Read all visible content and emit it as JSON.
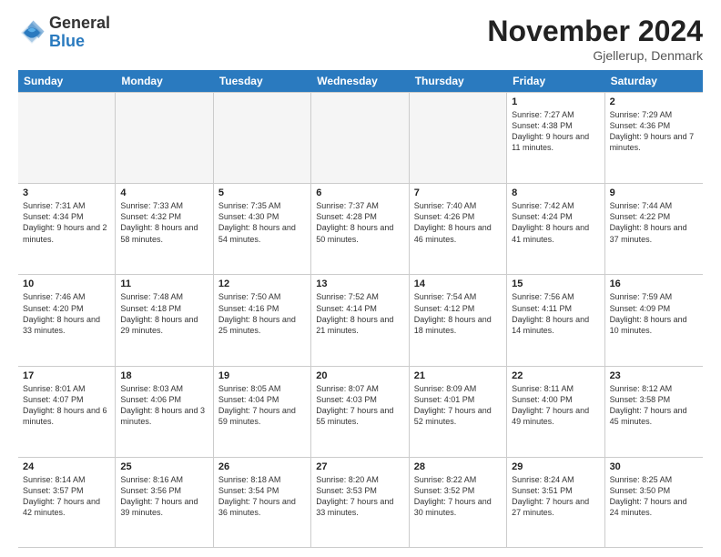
{
  "header": {
    "logo_general": "General",
    "logo_blue": "Blue",
    "month_title": "November 2024",
    "location": "Gjellerup, Denmark"
  },
  "days_of_week": [
    "Sunday",
    "Monday",
    "Tuesday",
    "Wednesday",
    "Thursday",
    "Friday",
    "Saturday"
  ],
  "weeks": [
    [
      {
        "day": "",
        "empty": true
      },
      {
        "day": "",
        "empty": true
      },
      {
        "day": "",
        "empty": true
      },
      {
        "day": "",
        "empty": true
      },
      {
        "day": "",
        "empty": true
      },
      {
        "day": "1",
        "sunrise": "Sunrise: 7:27 AM",
        "sunset": "Sunset: 4:38 PM",
        "daylight": "Daylight: 9 hours and 11 minutes."
      },
      {
        "day": "2",
        "sunrise": "Sunrise: 7:29 AM",
        "sunset": "Sunset: 4:36 PM",
        "daylight": "Daylight: 9 hours and 7 minutes."
      }
    ],
    [
      {
        "day": "3",
        "sunrise": "Sunrise: 7:31 AM",
        "sunset": "Sunset: 4:34 PM",
        "daylight": "Daylight: 9 hours and 2 minutes."
      },
      {
        "day": "4",
        "sunrise": "Sunrise: 7:33 AM",
        "sunset": "Sunset: 4:32 PM",
        "daylight": "Daylight: 8 hours and 58 minutes."
      },
      {
        "day": "5",
        "sunrise": "Sunrise: 7:35 AM",
        "sunset": "Sunset: 4:30 PM",
        "daylight": "Daylight: 8 hours and 54 minutes."
      },
      {
        "day": "6",
        "sunrise": "Sunrise: 7:37 AM",
        "sunset": "Sunset: 4:28 PM",
        "daylight": "Daylight: 8 hours and 50 minutes."
      },
      {
        "day": "7",
        "sunrise": "Sunrise: 7:40 AM",
        "sunset": "Sunset: 4:26 PM",
        "daylight": "Daylight: 8 hours and 46 minutes."
      },
      {
        "day": "8",
        "sunrise": "Sunrise: 7:42 AM",
        "sunset": "Sunset: 4:24 PM",
        "daylight": "Daylight: 8 hours and 41 minutes."
      },
      {
        "day": "9",
        "sunrise": "Sunrise: 7:44 AM",
        "sunset": "Sunset: 4:22 PM",
        "daylight": "Daylight: 8 hours and 37 minutes."
      }
    ],
    [
      {
        "day": "10",
        "sunrise": "Sunrise: 7:46 AM",
        "sunset": "Sunset: 4:20 PM",
        "daylight": "Daylight: 8 hours and 33 minutes."
      },
      {
        "day": "11",
        "sunrise": "Sunrise: 7:48 AM",
        "sunset": "Sunset: 4:18 PM",
        "daylight": "Daylight: 8 hours and 29 minutes."
      },
      {
        "day": "12",
        "sunrise": "Sunrise: 7:50 AM",
        "sunset": "Sunset: 4:16 PM",
        "daylight": "Daylight: 8 hours and 25 minutes."
      },
      {
        "day": "13",
        "sunrise": "Sunrise: 7:52 AM",
        "sunset": "Sunset: 4:14 PM",
        "daylight": "Daylight: 8 hours and 21 minutes."
      },
      {
        "day": "14",
        "sunrise": "Sunrise: 7:54 AM",
        "sunset": "Sunset: 4:12 PM",
        "daylight": "Daylight: 8 hours and 18 minutes."
      },
      {
        "day": "15",
        "sunrise": "Sunrise: 7:56 AM",
        "sunset": "Sunset: 4:11 PM",
        "daylight": "Daylight: 8 hours and 14 minutes."
      },
      {
        "day": "16",
        "sunrise": "Sunrise: 7:59 AM",
        "sunset": "Sunset: 4:09 PM",
        "daylight": "Daylight: 8 hours and 10 minutes."
      }
    ],
    [
      {
        "day": "17",
        "sunrise": "Sunrise: 8:01 AM",
        "sunset": "Sunset: 4:07 PM",
        "daylight": "Daylight: 8 hours and 6 minutes."
      },
      {
        "day": "18",
        "sunrise": "Sunrise: 8:03 AM",
        "sunset": "Sunset: 4:06 PM",
        "daylight": "Daylight: 8 hours and 3 minutes."
      },
      {
        "day": "19",
        "sunrise": "Sunrise: 8:05 AM",
        "sunset": "Sunset: 4:04 PM",
        "daylight": "Daylight: 7 hours and 59 minutes."
      },
      {
        "day": "20",
        "sunrise": "Sunrise: 8:07 AM",
        "sunset": "Sunset: 4:03 PM",
        "daylight": "Daylight: 7 hours and 55 minutes."
      },
      {
        "day": "21",
        "sunrise": "Sunrise: 8:09 AM",
        "sunset": "Sunset: 4:01 PM",
        "daylight": "Daylight: 7 hours and 52 minutes."
      },
      {
        "day": "22",
        "sunrise": "Sunrise: 8:11 AM",
        "sunset": "Sunset: 4:00 PM",
        "daylight": "Daylight: 7 hours and 49 minutes."
      },
      {
        "day": "23",
        "sunrise": "Sunrise: 8:12 AM",
        "sunset": "Sunset: 3:58 PM",
        "daylight": "Daylight: 7 hours and 45 minutes."
      }
    ],
    [
      {
        "day": "24",
        "sunrise": "Sunrise: 8:14 AM",
        "sunset": "Sunset: 3:57 PM",
        "daylight": "Daylight: 7 hours and 42 minutes."
      },
      {
        "day": "25",
        "sunrise": "Sunrise: 8:16 AM",
        "sunset": "Sunset: 3:56 PM",
        "daylight": "Daylight: 7 hours and 39 minutes."
      },
      {
        "day": "26",
        "sunrise": "Sunrise: 8:18 AM",
        "sunset": "Sunset: 3:54 PM",
        "daylight": "Daylight: 7 hours and 36 minutes."
      },
      {
        "day": "27",
        "sunrise": "Sunrise: 8:20 AM",
        "sunset": "Sunset: 3:53 PM",
        "daylight": "Daylight: 7 hours and 33 minutes."
      },
      {
        "day": "28",
        "sunrise": "Sunrise: 8:22 AM",
        "sunset": "Sunset: 3:52 PM",
        "daylight": "Daylight: 7 hours and 30 minutes."
      },
      {
        "day": "29",
        "sunrise": "Sunrise: 8:24 AM",
        "sunset": "Sunset: 3:51 PM",
        "daylight": "Daylight: 7 hours and 27 minutes."
      },
      {
        "day": "30",
        "sunrise": "Sunrise: 8:25 AM",
        "sunset": "Sunset: 3:50 PM",
        "daylight": "Daylight: 7 hours and 24 minutes."
      }
    ]
  ]
}
